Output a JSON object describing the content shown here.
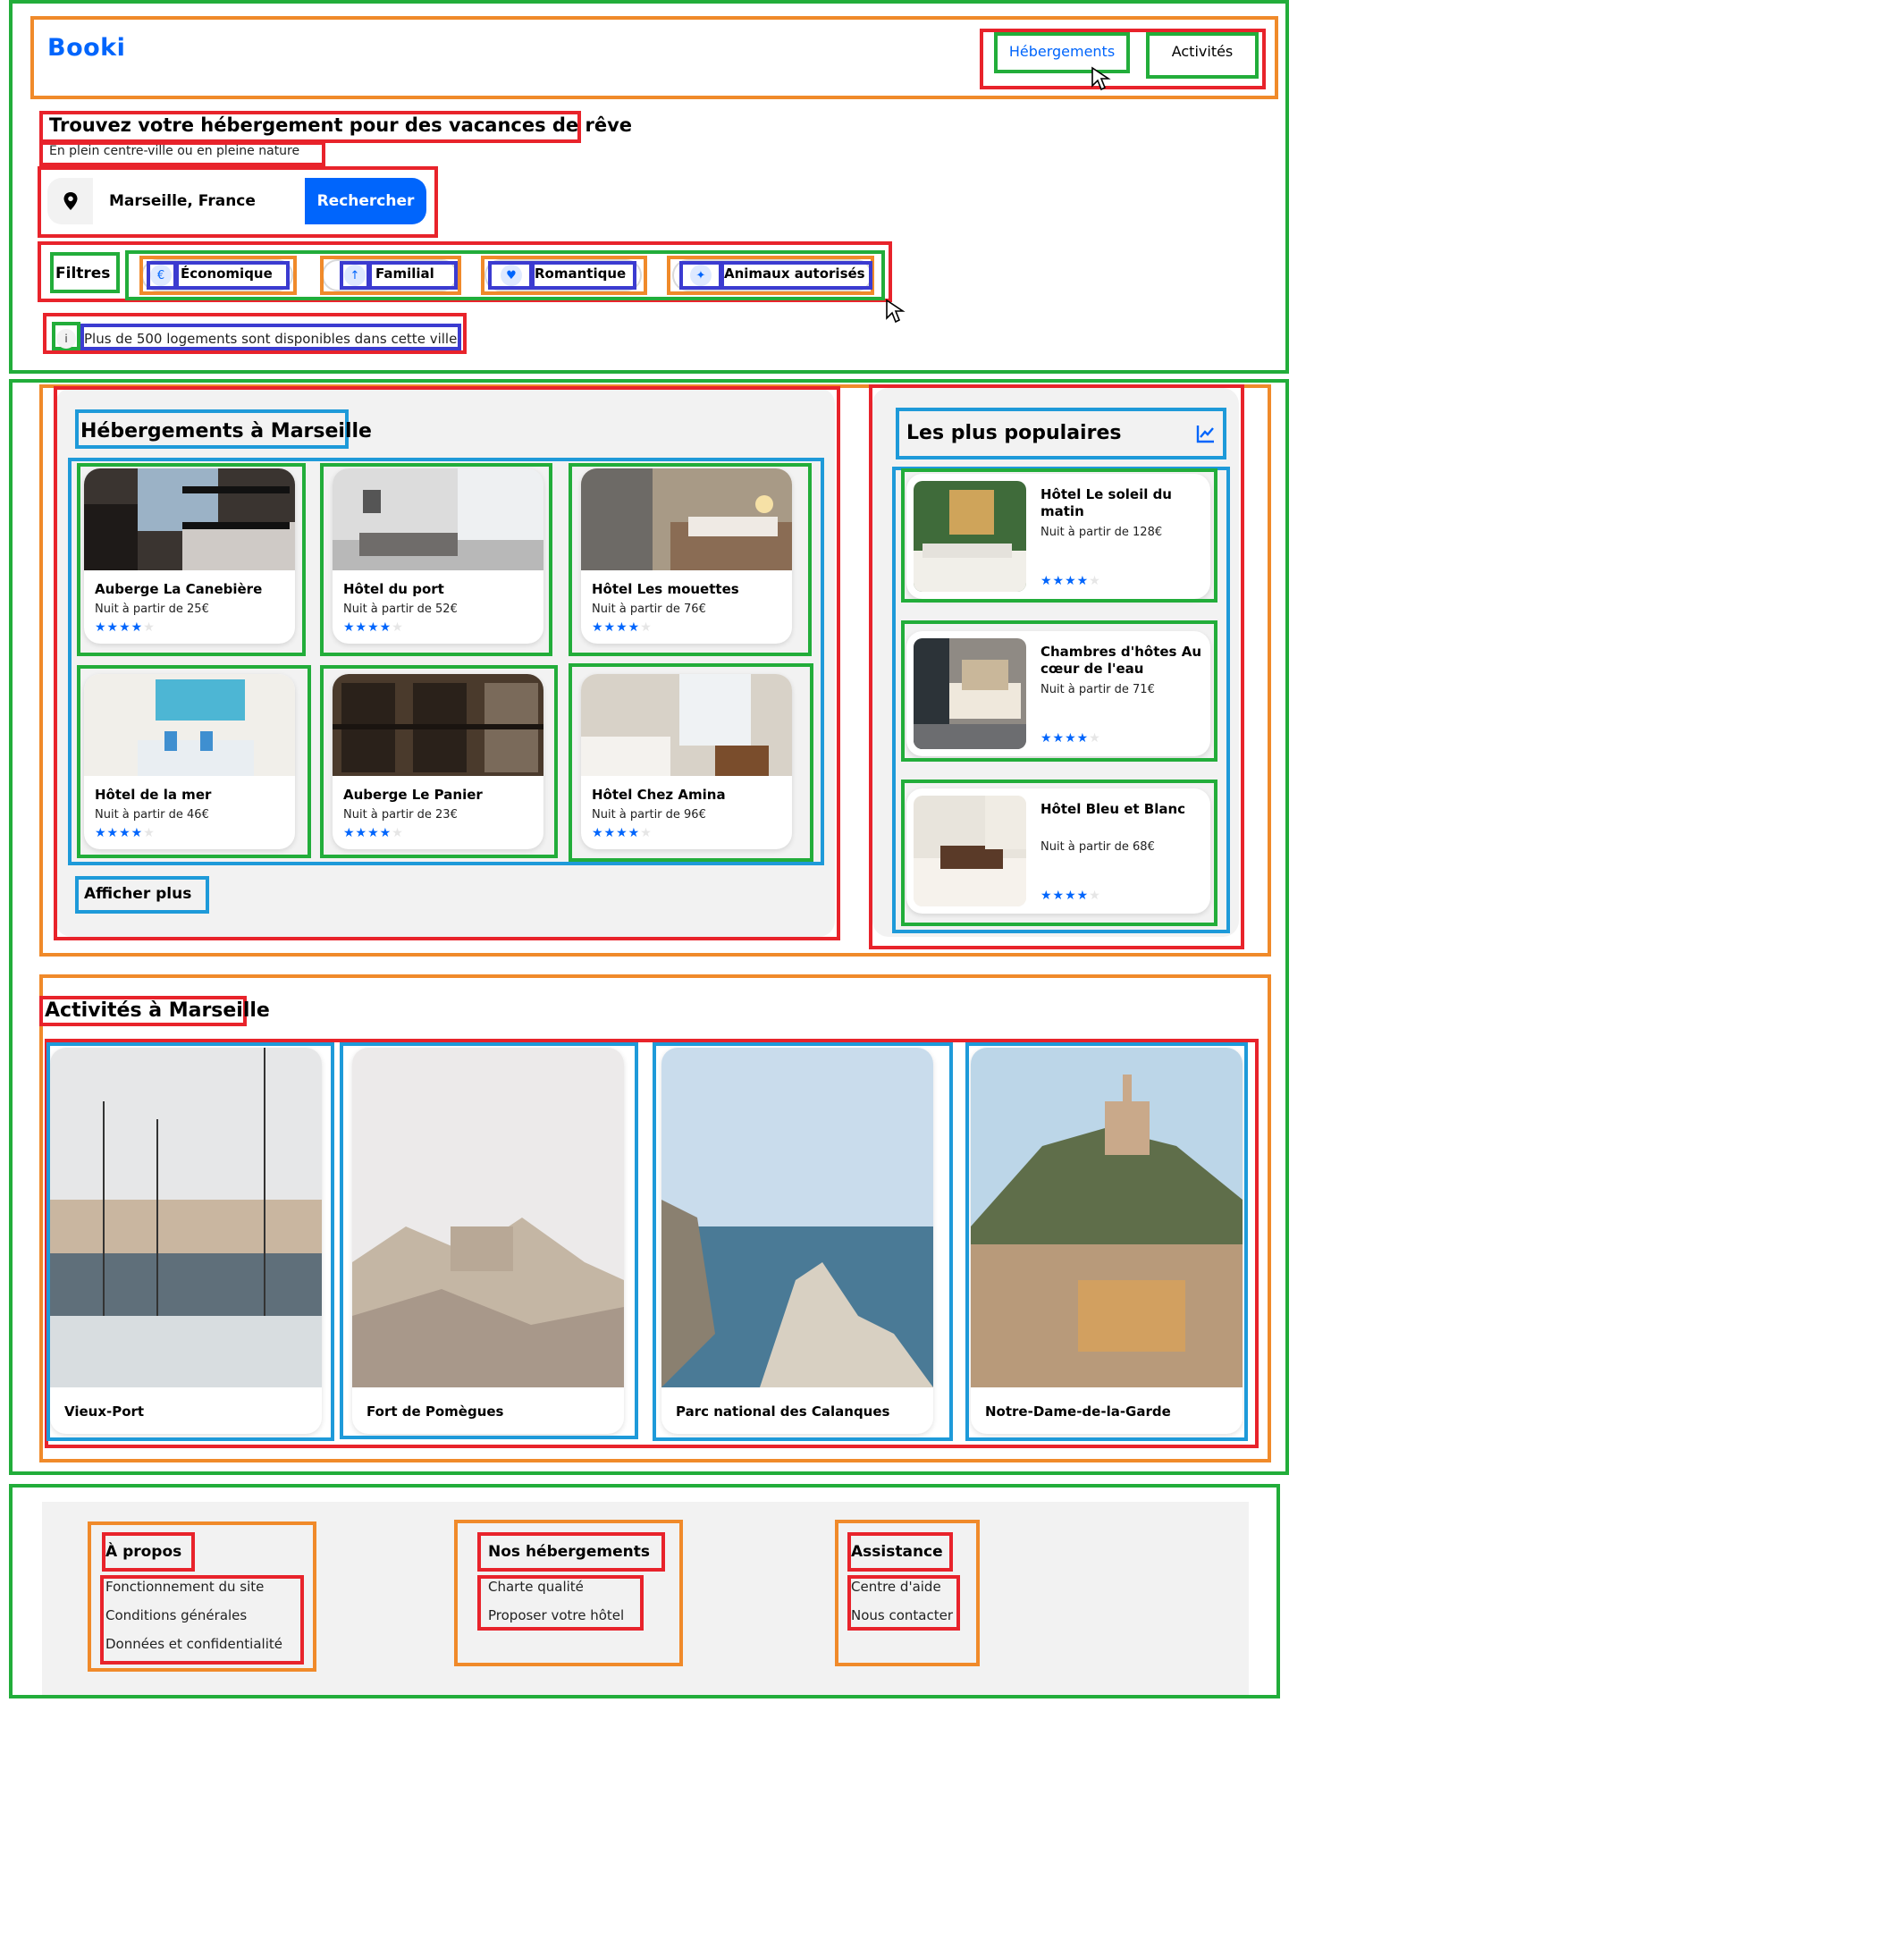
{
  "header": {
    "logo": "Booki",
    "nav": [
      {
        "label": "Hébergements",
        "active": true
      },
      {
        "label": "Activités",
        "active": false
      }
    ]
  },
  "hero": {
    "title": "Trouvez votre hébergement pour des vacances de rêve",
    "subtitle": "En plein centre-ville ou en pleine nature",
    "search": {
      "value": "Marseille, France",
      "button": "Rechercher",
      "icon": "map-pin-icon"
    }
  },
  "filters": {
    "label": "Filtres",
    "chips": [
      {
        "label": "Économique",
        "icon": "money-icon"
      },
      {
        "label": "Familial",
        "icon": "child-icon"
      },
      {
        "label": "Romantique",
        "icon": "heart-icon"
      },
      {
        "label": "Animaux autorisés",
        "icon": "dog-icon"
      }
    ]
  },
  "info": {
    "icon": "info-icon",
    "text": "Plus de 500 logements sont disponibles dans cette ville"
  },
  "lodging": {
    "title": "Hébergements à Marseille",
    "more": "Afficher plus",
    "cards": [
      {
        "name": "Auberge La Canebière",
        "price": "Nuit à partir de 25€",
        "rating": 4
      },
      {
        "name": "Hôtel du port",
        "price": "Nuit à partir de 52€",
        "rating": 4
      },
      {
        "name": "Hôtel Les mouettes",
        "price": "Nuit à partir de 76€",
        "rating": 4
      },
      {
        "name": "Hôtel de la mer",
        "price": "Nuit à partir de 46€",
        "rating": 4
      },
      {
        "name": "Auberge Le Panier",
        "price": "Nuit à partir de 23€",
        "rating": 4
      },
      {
        "name": "Hôtel Chez Amina",
        "price": "Nuit à partir de 96€",
        "rating": 4
      }
    ]
  },
  "popular": {
    "title": "Les plus populaires",
    "icon": "trend-chart-icon",
    "cards": [
      {
        "name": "Hôtel Le soleil du matin",
        "price": "Nuit à partir de 128€",
        "rating": 4
      },
      {
        "name": "Chambres d'hôtes Au cœur de l'eau",
        "price": "Nuit à partir de 71€",
        "rating": 4
      },
      {
        "name": "Hôtel Bleu et Blanc",
        "price": "Nuit à partir de 68€",
        "rating": 4
      }
    ]
  },
  "activities": {
    "title": "Activités à Marseille",
    "cards": [
      {
        "name": "Vieux-Port"
      },
      {
        "name": "Fort de Pomègues"
      },
      {
        "name": "Parc national des Calanques"
      },
      {
        "name": "Notre-Dame-de-la-Garde"
      }
    ]
  },
  "footer": {
    "columns": [
      {
        "title": "À propos",
        "links": [
          "Fonctionnement du site",
          "Conditions générales",
          "Données et confidentialité"
        ]
      },
      {
        "title": "Nos hébergements",
        "links": [
          "Charte qualité",
          "Proposer votre hôtel"
        ]
      },
      {
        "title": "Assistance",
        "links": [
          "Centre d'aide",
          "Nous contacter"
        ]
      }
    ]
  },
  "colors": {
    "primary": "#0065fc",
    "light_blue": "#dee9ff",
    "grey_bg": "#f2f2f2"
  }
}
